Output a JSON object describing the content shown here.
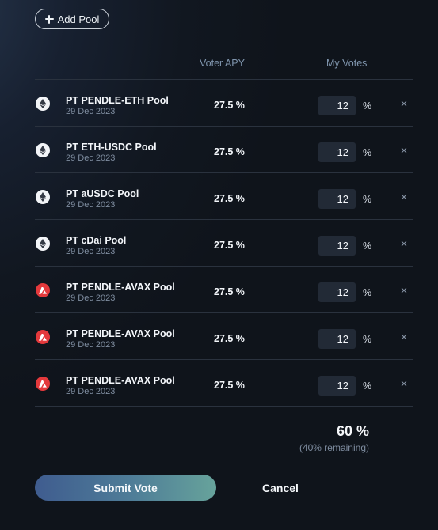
{
  "header": {
    "add_pool_label": "Add Pool"
  },
  "columns": {
    "voter_apy": "Voter APY",
    "my_votes": "My Votes"
  },
  "rows": [
    {
      "name": "PT PENDLE-ETH Pool",
      "date": "29 Dec 2023",
      "apy": "27.5 %",
      "votes": "12",
      "unit": "%",
      "icon": "eth-icon",
      "remove": "×"
    },
    {
      "name": "PT ETH-USDC Pool",
      "date": "29 Dec 2023",
      "apy": "27.5 %",
      "votes": "12",
      "unit": "%",
      "icon": "eth-icon",
      "remove": "×"
    },
    {
      "name": "PT aUSDC Pool",
      "date": "29 Dec 2023",
      "apy": "27.5 %",
      "votes": "12",
      "unit": "%",
      "icon": "eth-icon",
      "remove": "×"
    },
    {
      "name": "PT cDai Pool",
      "date": "29 Dec 2023",
      "apy": "27.5 %",
      "votes": "12",
      "unit": "%",
      "icon": "eth-icon",
      "remove": "×"
    },
    {
      "name": "PT PENDLE-AVAX Pool",
      "date": "29 Dec 2023",
      "apy": "27.5 %",
      "votes": "12",
      "unit": "%",
      "icon": "avax-icon",
      "remove": "×"
    },
    {
      "name": "PT PENDLE-AVAX Pool",
      "date": "29 Dec 2023",
      "apy": "27.5 %",
      "votes": "12",
      "unit": "%",
      "icon": "avax-icon",
      "remove": "×"
    },
    {
      "name": "PT PENDLE-AVAX Pool",
      "date": "29 Dec 2023",
      "apy": "27.5 %",
      "votes": "12",
      "unit": "%",
      "icon": "avax-icon",
      "remove": "×"
    }
  ],
  "summary": {
    "total": "60 %",
    "remaining": "(40% remaining)"
  },
  "actions": {
    "submit_label": "Submit Vote",
    "cancel_label": "Cancel"
  },
  "colors": {
    "eth_icon_bg": "#f2f4f7",
    "avax_icon_bg": "#e4393c",
    "submit_gradient_start": "#3f5c8f",
    "submit_gradient_end": "#67a39b"
  }
}
